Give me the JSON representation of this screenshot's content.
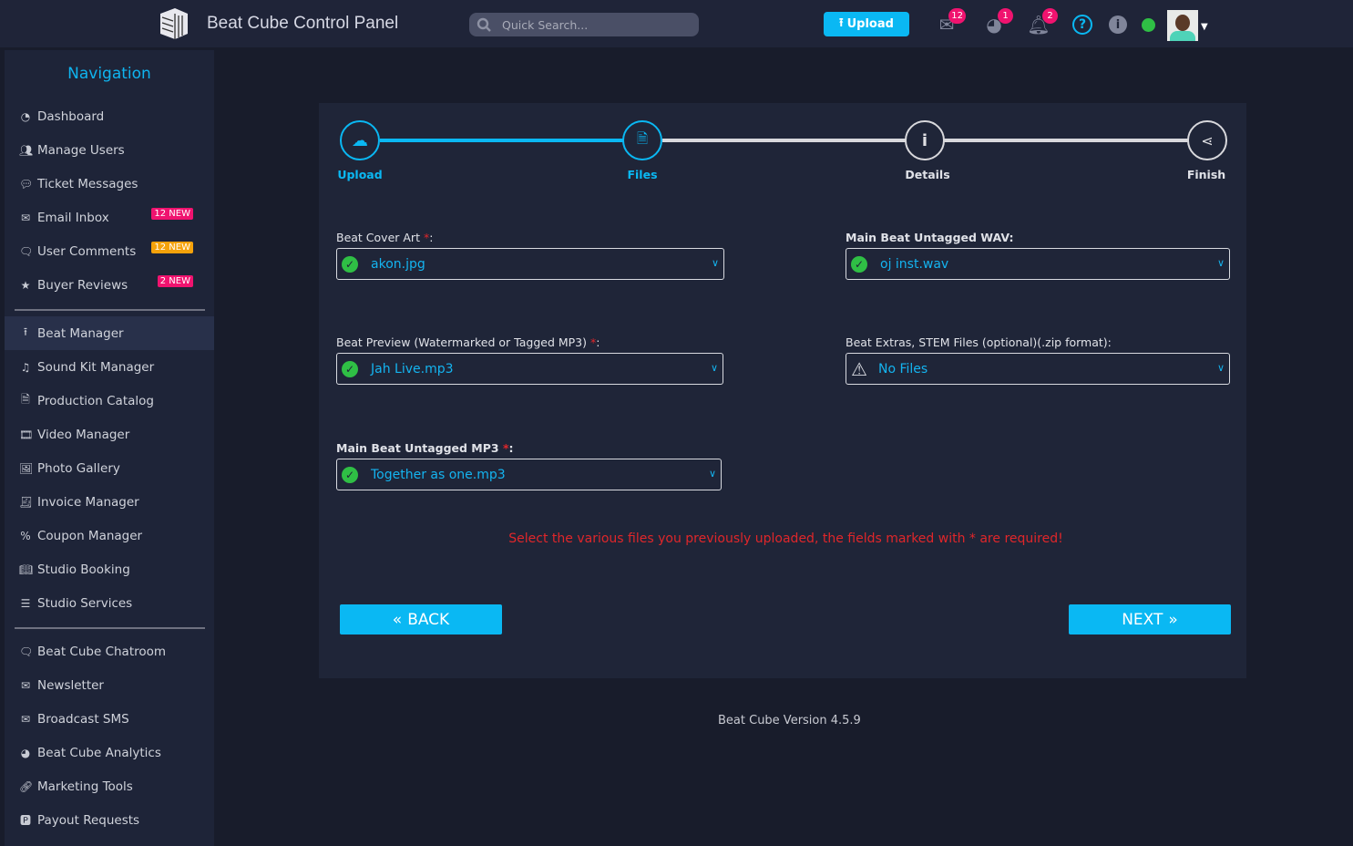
{
  "header": {
    "title": "Beat Cube Control Panel",
    "logo_text": "BC",
    "search_placeholder": "Quick Search...",
    "upload_label": "Upload",
    "mail_count": "12",
    "globe_count": "1",
    "bell_count": "2"
  },
  "colors": {
    "accent": "#0ab8f3",
    "badge_pink": "#f0136f",
    "badge_orange": "#f5a20b",
    "online": "#2fbf45",
    "error": "#e0262a"
  },
  "sidebar": {
    "title": "Navigation",
    "group1": [
      {
        "label": "Dashboard",
        "icon": "dashboard-icon"
      },
      {
        "label": "Manage Users",
        "icon": "users-icon"
      },
      {
        "label": "Ticket Messages",
        "icon": "comments-icon"
      },
      {
        "label": "Email Inbox",
        "icon": "envelope-icon",
        "badge": "12 NEW"
      },
      {
        "label": "User Comments",
        "icon": "comment-icon",
        "badge": "12 NEW"
      },
      {
        "label": "Buyer Reviews",
        "icon": "star-icon",
        "badge": "2 NEW"
      }
    ],
    "group2": [
      {
        "label": "Beat Manager"
      },
      {
        "label": "Sound Kit Manager"
      },
      {
        "label": "Production Catalog"
      },
      {
        "label": "Video Manager"
      },
      {
        "label": "Photo Gallery"
      },
      {
        "label": "Invoice Manager"
      },
      {
        "label": "Coupon Manager"
      },
      {
        "label": "Studio Booking"
      },
      {
        "label": "Studio Services"
      }
    ],
    "group3": [
      {
        "label": "Beat Cube Chatroom"
      },
      {
        "label": "Newsletter"
      },
      {
        "label": "Broadcast SMS"
      },
      {
        "label": "Beat Cube Analytics"
      },
      {
        "label": "Marketing Tools"
      },
      {
        "label": "Payout Requests"
      }
    ]
  },
  "wizard": {
    "steps": [
      "Upload",
      "Files",
      "Details",
      "Finish"
    ],
    "current_step": 2
  },
  "form": {
    "cover_label": "Beat Cover Art ",
    "cover_value": "akon.jpg",
    "wav_label": "Main Beat Untagged WAV:",
    "wav_value": "oj inst.wav",
    "preview_label": "Beat Preview (Watermarked or Tagged MP3) ",
    "preview_value": "Jah Live.mp3",
    "extras_label": "Beat Extras, STEM Files (optional)(.zip format):",
    "extras_value": "No Files",
    "mp3_label": "Main Beat Untagged MP3 ",
    "mp3_value": "Together as one.mp3",
    "required_mark": "*",
    "colon": ":",
    "message": "Select the various files you previously uploaded, the fields marked with * are required!",
    "back_label": "BACK",
    "next_label": "NEXT"
  },
  "footer": "Beat Cube Version 4.5.9"
}
